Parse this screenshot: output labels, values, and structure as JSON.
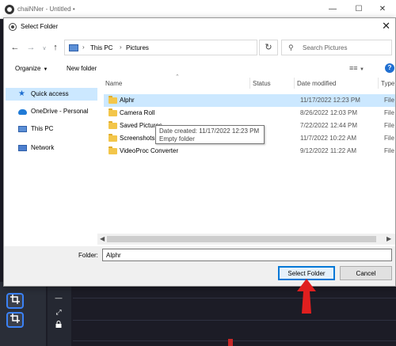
{
  "app": {
    "title": "chaiNNer - Untitled",
    "title_suffix": "•",
    "minimize": "—",
    "maximize": "☐",
    "close": "✕",
    "tool_icons": [
      "crop-icon",
      "crop-icon"
    ],
    "panel_icons": [
      "minus-icon",
      "expand-icon",
      "lock-icon"
    ]
  },
  "dialog": {
    "title": "Select Folder",
    "close": "✕",
    "address": {
      "path": [
        "This PC",
        "Pictures"
      ],
      "separator": "›"
    },
    "search": {
      "placeholder": "Search Pictures"
    },
    "toolbar": {
      "organize": "Organize",
      "new_folder": "New folder",
      "help": "?"
    },
    "nav_pane": {
      "items": [
        {
          "label": "Quick access",
          "icon": "star-icon",
          "selected": true
        },
        {
          "label": "OneDrive - Personal",
          "icon": "cloud-icon",
          "selected": false
        },
        {
          "label": "This PC",
          "icon": "computer-icon",
          "selected": false
        },
        {
          "label": "Network",
          "icon": "network-icon",
          "selected": false
        }
      ]
    },
    "columns": {
      "name": "Name",
      "status": "Status",
      "date_modified": "Date modified",
      "type": "Type"
    },
    "files": [
      {
        "name": "Alphr",
        "date": "11/17/2022 12:23 PM",
        "type": "File fo",
        "selected": true
      },
      {
        "name": "Camera Roll",
        "date": "8/26/2022 12:03 PM",
        "type": "File fo",
        "selected": false
      },
      {
        "name": "Saved Pictures",
        "date": "7/22/2022 12:44 PM",
        "type": "File fo",
        "selected": false
      },
      {
        "name": "Screenshots",
        "date": "11/7/2022 10:22 AM",
        "type": "File fo",
        "selected": false
      },
      {
        "name": "VideoProc Converter",
        "date": "9/12/2022 11:22 AM",
        "type": "File fo",
        "selected": false
      }
    ],
    "tooltip": {
      "line1": "Date created: 11/17/2022 12:23 PM",
      "line2": "Empty folder"
    },
    "folder": {
      "label": "Folder:",
      "value": "Alphr"
    },
    "buttons": {
      "select": "Select Folder",
      "cancel": "Cancel"
    }
  },
  "colors": {
    "accent": "#0078d7",
    "selection": "#cce8ff",
    "arrow": "#e01f1f",
    "folder": "#f3c64a"
  }
}
